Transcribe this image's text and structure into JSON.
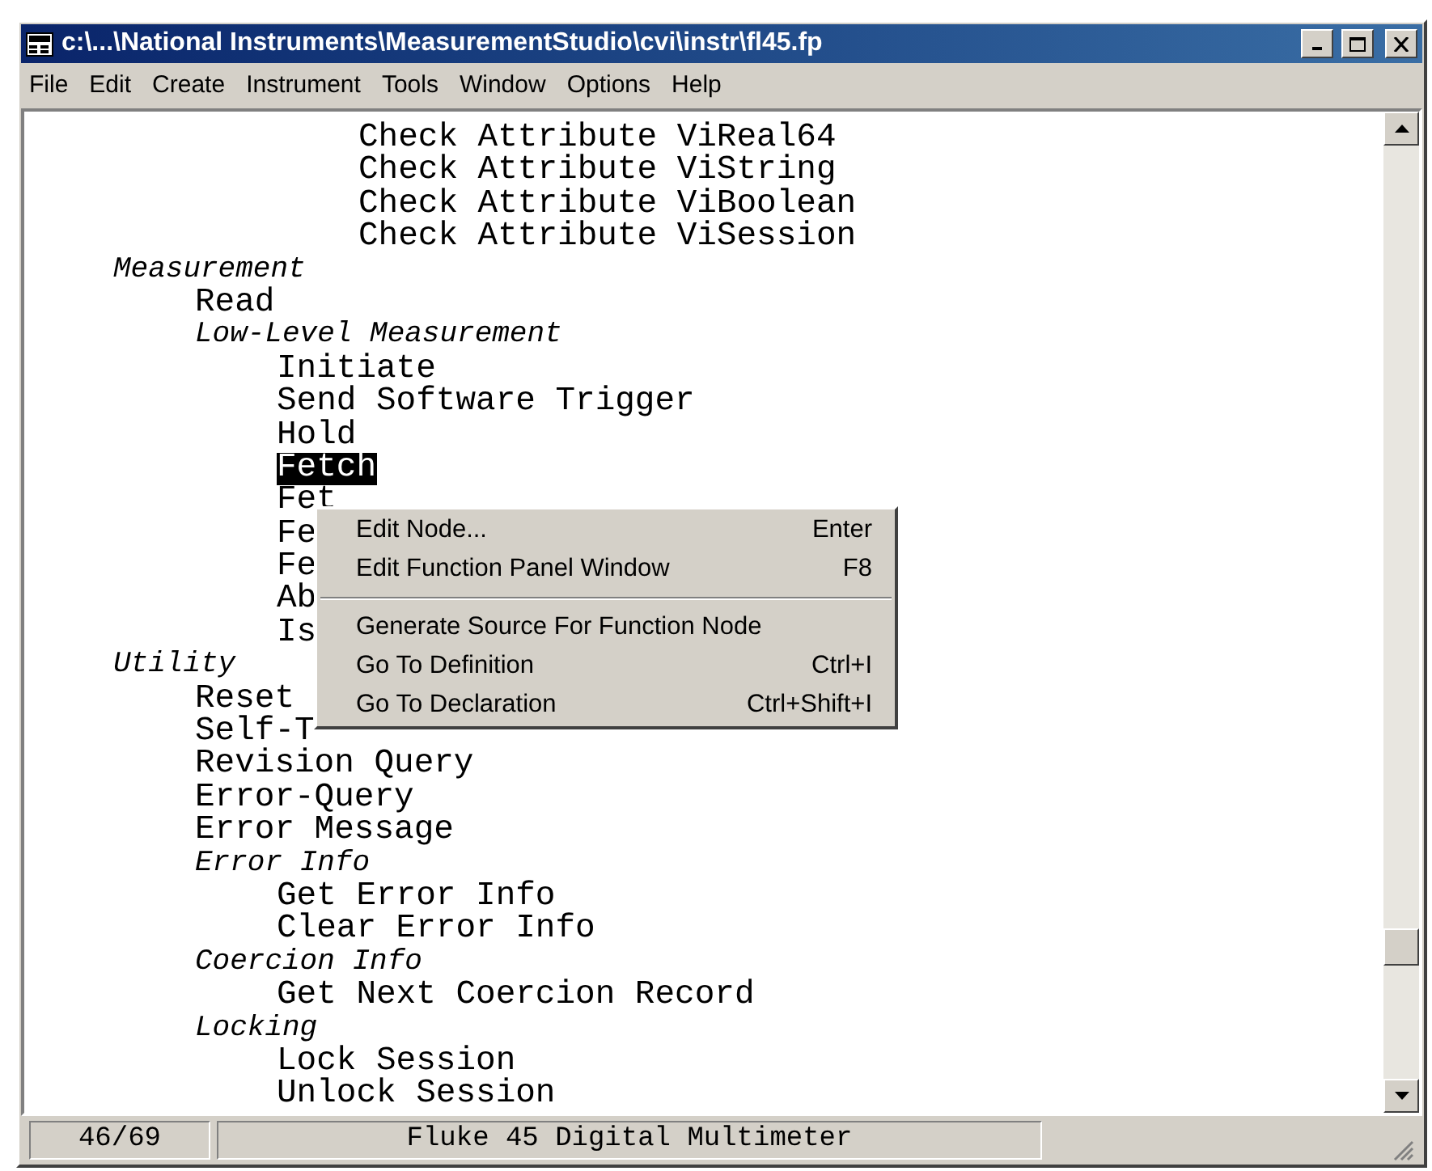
{
  "window": {
    "title": "c:\\...\\National Instruments\\MeasurementStudio\\cvi\\instr\\fl45.fp"
  },
  "menu_bar": [
    "File",
    "Edit",
    "Create",
    "Instrument",
    "Tools",
    "Window",
    "Options",
    "Help"
  ],
  "tree": [
    {
      "children": [
        {
          "children": [
            {
              "children": [
                {
                  "label": "Check Attribute ViReal64",
                  "kind": "function",
                  "selected": false
                },
                {
                  "label": "Check Attribute ViString",
                  "kind": "function",
                  "selected": false
                },
                {
                  "label": "Check Attribute ViBoolean",
                  "kind": "function",
                  "selected": false
                },
                {
                  "label": "Check Attribute ViSession",
                  "kind": "function",
                  "selected": false
                }
              ]
            }
          ]
        }
      ]
    },
    {
      "label": "Measurement",
      "kind": "class",
      "selected": false,
      "children": [
        {
          "label": "Read",
          "kind": "function",
          "selected": false
        },
        {
          "label": "Low-Level Measurement",
          "kind": "class",
          "selected": false,
          "children": [
            {
              "label": "Initiate",
              "kind": "function",
              "selected": false
            },
            {
              "label": "Send Software Trigger",
              "kind": "function",
              "selected": false
            },
            {
              "label": "Hold",
              "kind": "function",
              "selected": false
            },
            {
              "label": "Fetch",
              "kind": "function",
              "selected": true
            },
            {
              "label": "Fet",
              "kind": "function",
              "selected": false
            },
            {
              "label": "Fe",
              "kind": "function",
              "selected": false
            },
            {
              "label": "Fe",
              "kind": "function",
              "selected": false
            },
            {
              "label": "Ab",
              "kind": "function",
              "selected": false
            },
            {
              "label": "Is",
              "kind": "function",
              "selected": false
            }
          ]
        }
      ]
    },
    {
      "label": "Utility",
      "kind": "class",
      "selected": false,
      "children": [
        {
          "label": "Reset",
          "kind": "function",
          "selected": false
        },
        {
          "label": "Self-T",
          "kind": "function",
          "selected": false
        },
        {
          "label": "Revision Query",
          "kind": "function",
          "selected": false
        },
        {
          "label": "Error-Query",
          "kind": "function",
          "selected": false
        },
        {
          "label": "Error Message",
          "kind": "function",
          "selected": false
        },
        {
          "label": "Error Info",
          "kind": "class",
          "selected": false,
          "children": [
            {
              "label": "Get Error Info",
              "kind": "function",
              "selected": false
            },
            {
              "label": "Clear Error Info",
              "kind": "function",
              "selected": false
            }
          ]
        },
        {
          "label": "Coercion Info",
          "kind": "class",
          "selected": false,
          "children": [
            {
              "label": "Get Next Coercion Record",
              "kind": "function",
              "selected": false
            }
          ]
        },
        {
          "label": "Locking",
          "kind": "class",
          "selected": false,
          "children": [
            {
              "label": "Lock Session",
              "kind": "function",
              "selected": false
            },
            {
              "label": "Unlock Session",
              "kind": "function",
              "selected": false
            }
          ]
        }
      ]
    }
  ],
  "context_menu": [
    {
      "kind": "item",
      "label": "Edit Node...",
      "shortcut": "Enter"
    },
    {
      "kind": "item",
      "label": "Edit Function Panel Window",
      "shortcut": "F8"
    },
    {
      "kind": "separator"
    },
    {
      "kind": "item",
      "label": "Generate Source For Function Node"
    },
    {
      "kind": "item",
      "label": "Go To Definition",
      "shortcut": "Ctrl+I"
    },
    {
      "kind": "item",
      "label": "Go To Declaration",
      "shortcut": "Ctrl+Shift+I"
    }
  ],
  "status_bar": {
    "position": "46/69",
    "description": "Fluke 45 Digital Multimeter"
  }
}
